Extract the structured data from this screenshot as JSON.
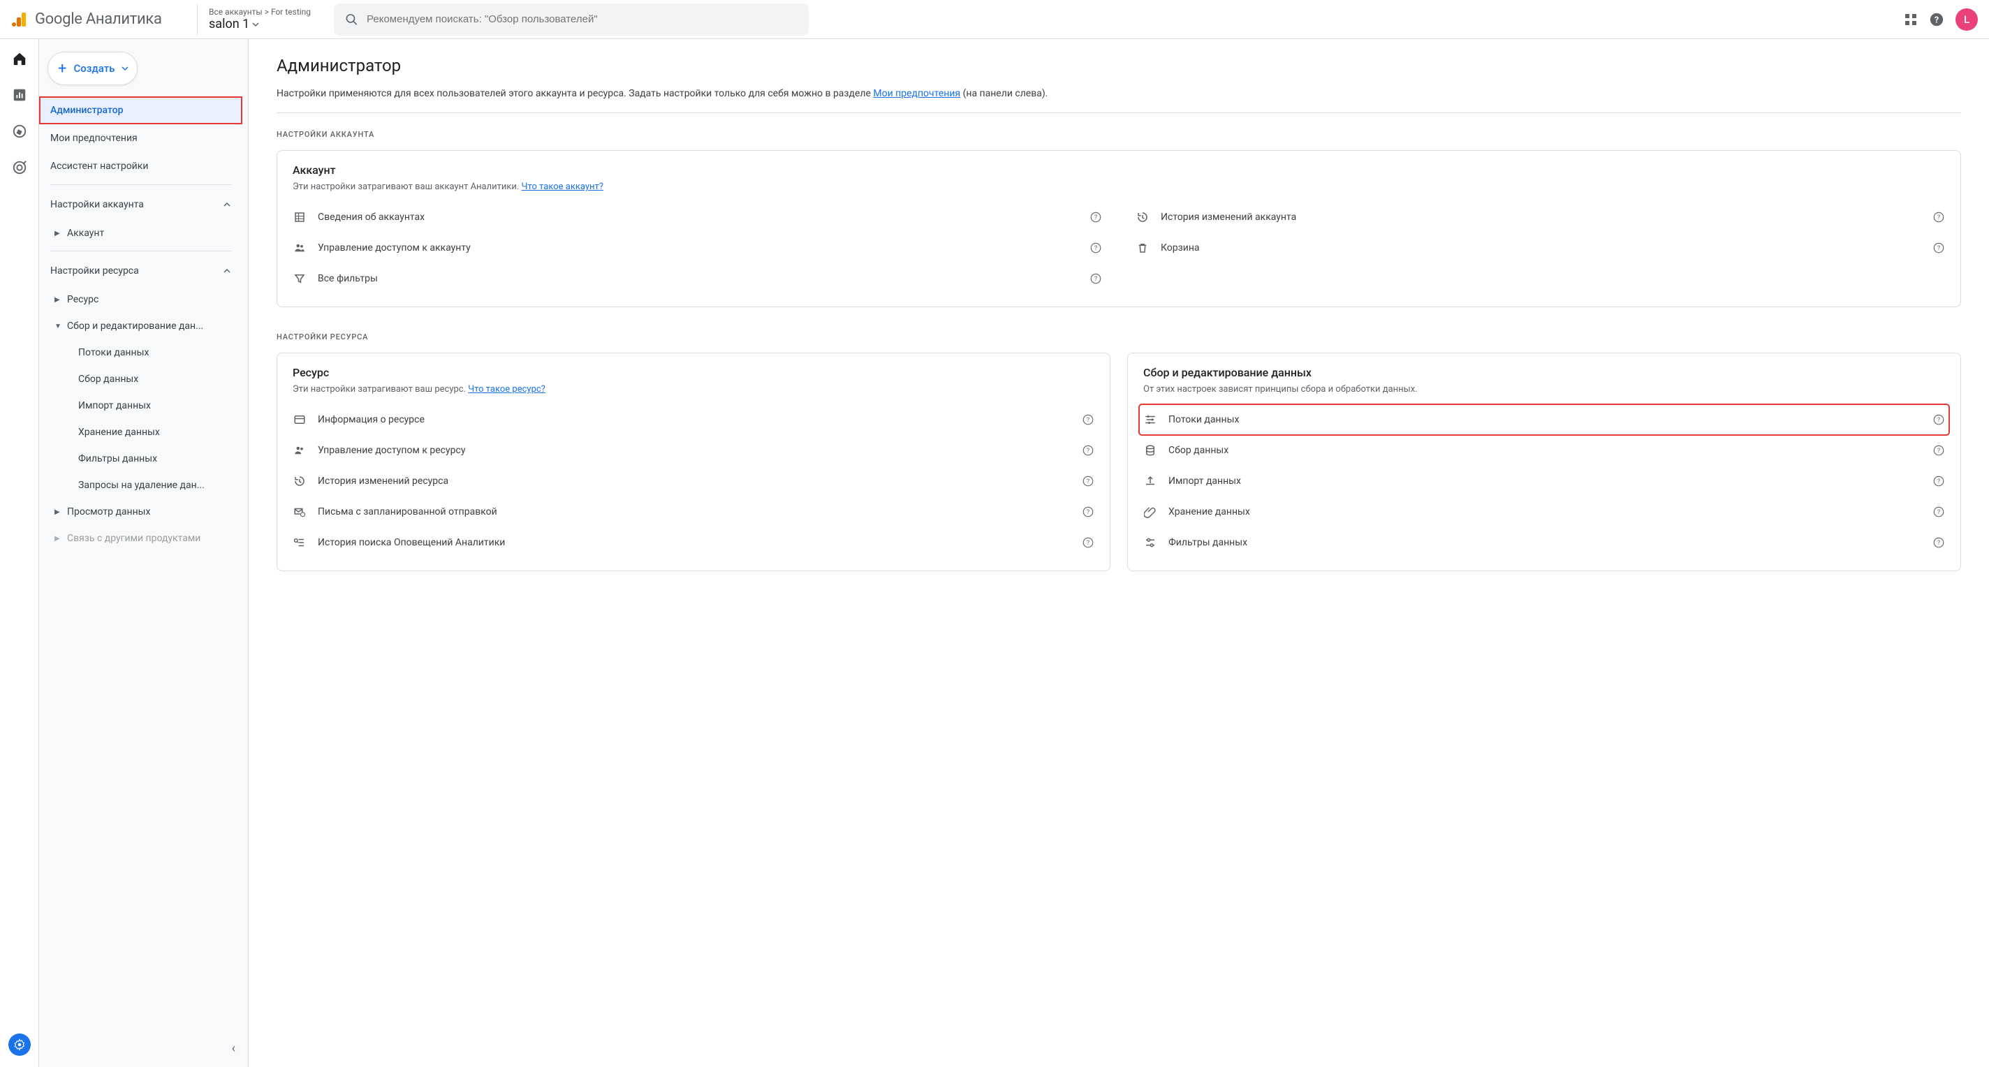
{
  "header": {
    "logo_text_1": "Google",
    "logo_text_2": "Аналитика",
    "breadcrumb": "Все аккаунты > For testing",
    "property_name": "salon 1",
    "search_placeholder": "Рекомендуем поискать: \"Обзор пользователей\"",
    "avatar_letter": "L"
  },
  "create_button": {
    "label": "Создать"
  },
  "side_nav": {
    "administrator": "Администратор",
    "my_preferences": "Мои предпочтения",
    "setup_assistant": "Ассистент настройки",
    "account_settings": "Настройки аккаунта",
    "account": "Аккаунт",
    "property_settings": "Настройки ресурса",
    "property": "Ресурс",
    "data_collection_edit": "Сбор и редактирование дан...",
    "data_streams": "Потоки данных",
    "data_collection": "Сбор данных",
    "data_import": "Импорт данных",
    "data_retention": "Хранение данных",
    "data_filters": "Фильтры данных",
    "deletion_requests": "Запросы на удаление дан...",
    "data_display": "Просмотр данных",
    "product_links": "Связь с другими продуктами"
  },
  "main": {
    "title": "Администратор",
    "intro_text_1": "Настройки применяются для всех пользователей этого аккаунта и ресурса. Задать настройки только для себя можно в разделе ",
    "intro_link": "Мои предпочтения",
    "intro_text_2": " (на панели слева).",
    "section_account": "НАСТРОЙКИ АККАУНТА",
    "section_property": "НАСТРОЙКИ РЕСУРСА",
    "account_card": {
      "title": "Аккаунт",
      "desc": "Эти настройки затрагивают ваш аккаунт Аналитики. ",
      "desc_link": "Что такое аккаунт?",
      "items": {
        "account_details": "Сведения об аккаунтах",
        "account_access": "Управление доступом к аккаунту",
        "all_filters": "Все фильтры",
        "change_history": "История изменений аккаунта",
        "trash": "Корзина"
      }
    },
    "property_card": {
      "title": "Ресурс",
      "desc": "Эти настройки затрагивают ваш ресурс. ",
      "desc_link": "Что такое ресурс?",
      "items": {
        "property_details": "Информация о ресурсе",
        "property_access": "Управление доступом к ресурсу",
        "property_change_history": "История изменений ресурса",
        "scheduled_emails": "Письма с запланированной отправкой",
        "analytics_intelligence": "История поиска Оповещений Аналитики"
      }
    },
    "data_card": {
      "title": "Сбор и редактирование данных",
      "desc": "От этих настроек зависят принципы сбора и обработки данных.",
      "items": {
        "data_streams": "Потоки данных",
        "data_collection": "Сбор данных",
        "data_import": "Импорт данных",
        "data_retention": "Хранение данных",
        "data_filters": "Фильтры данных"
      }
    }
  }
}
